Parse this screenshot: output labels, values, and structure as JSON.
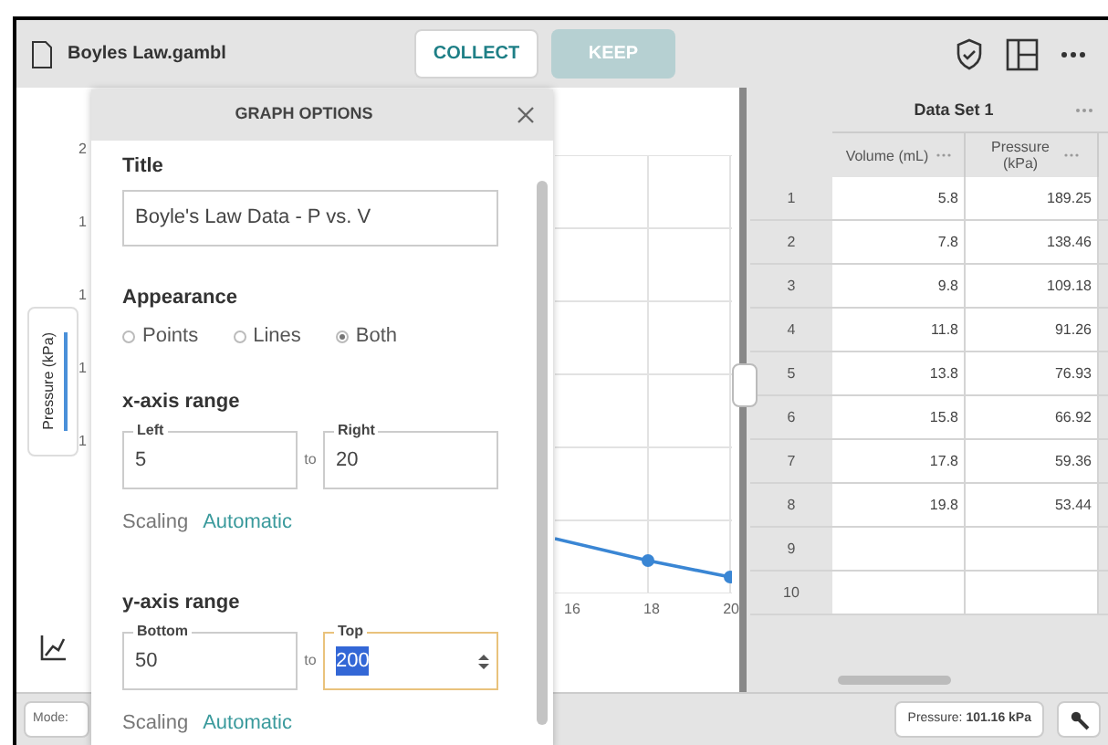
{
  "window": {
    "filename": "Boyles Law.gambl"
  },
  "toolbar": {
    "buttons": [
      {
        "label": "COLLECT",
        "disabled": false
      },
      {
        "label": "KEEP",
        "disabled": true
      }
    ]
  },
  "graph": {
    "y_axis_label": "Pressure (kPa)",
    "y_tick_labels": [
      "2",
      "1",
      "1",
      "1",
      "1"
    ],
    "x_tick_labels": [
      "16",
      "18",
      "20"
    ]
  },
  "graph_options": {
    "heading": "GRAPH OPTIONS",
    "title_label": "Title",
    "title_value": "Boyle's Law Data - P vs. V",
    "appearance_label": "Appearance",
    "appearance": [
      {
        "label": "Points",
        "selected": false
      },
      {
        "label": "Lines",
        "selected": false
      },
      {
        "label": "Both",
        "selected": true
      }
    ],
    "axes": [
      {
        "heading": "x-axis range",
        "fields": [
          {
            "label": "Left",
            "value": "5",
            "focused": false
          },
          {
            "label": "Right",
            "value": "20",
            "focused": false
          }
        ],
        "to": "to",
        "scaling_label": "Scaling",
        "scaling_value": "Automatic"
      },
      {
        "heading": "y-axis range",
        "fields": [
          {
            "label": "Bottom",
            "value": "50",
            "focused": false
          },
          {
            "label": "Top",
            "value": "200",
            "focused": true
          }
        ],
        "to": "to",
        "scaling_label": "Scaling",
        "scaling_value": "Automatic"
      }
    ]
  },
  "table": {
    "dataset": "Data Set 1",
    "columns": [
      "Volume (mL)",
      "Pressure (kPa)"
    ],
    "rows": [
      {
        "number": "1",
        "cells": [
          "5.8",
          "189.25"
        ]
      },
      {
        "number": "2",
        "cells": [
          "7.8",
          "138.46"
        ]
      },
      {
        "number": "3",
        "cells": [
          "9.8",
          "109.18"
        ]
      },
      {
        "number": "4",
        "cells": [
          "11.8",
          "91.26"
        ]
      },
      {
        "number": "5",
        "cells": [
          "13.8",
          "76.93"
        ]
      },
      {
        "number": "6",
        "cells": [
          "15.8",
          "66.92"
        ]
      },
      {
        "number": "7",
        "cells": [
          "17.8",
          "59.36"
        ]
      },
      {
        "number": "8",
        "cells": [
          "19.8",
          "53.44"
        ]
      },
      {
        "number": "9",
        "cells": []
      },
      {
        "number": "10",
        "cells": []
      }
    ]
  },
  "status": {
    "mode_label": "Mode:",
    "reading_label": "Pressure:",
    "reading_value": "101.16 kPa"
  }
}
